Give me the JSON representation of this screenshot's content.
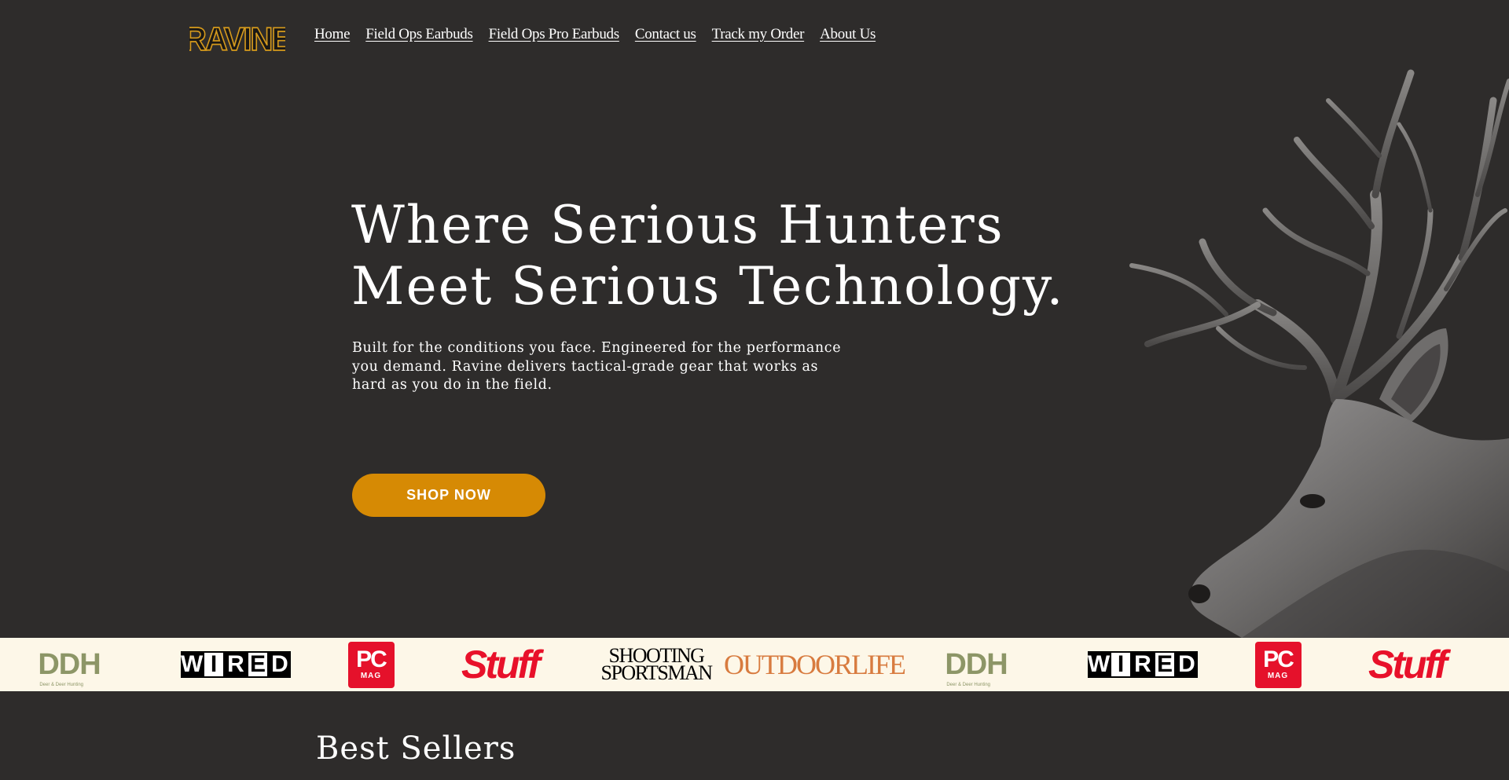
{
  "brand": {
    "logo_text": "RAVINE"
  },
  "nav": {
    "items": [
      {
        "label": "Home"
      },
      {
        "label": "Field Ops Earbuds"
      },
      {
        "label": "Field Ops Pro Earbuds"
      },
      {
        "label": "Contact us"
      },
      {
        "label": "Track my Order"
      },
      {
        "label": "About Us"
      }
    ]
  },
  "hero": {
    "title_line1": "Where Serious Hunters",
    "title_line2": "Meet Serious Technology.",
    "subtitle": "Built for the conditions you face. Engineered for the performance you demand. Ravine delivers tactical-grade gear that works as hard as you do in the field.",
    "cta_label": "SHOP NOW"
  },
  "press": {
    "logos": [
      {
        "name": "ddh",
        "text": "DDH",
        "sub": "Deer & Deer Hunting"
      },
      {
        "name": "wired",
        "text": "WIRED"
      },
      {
        "name": "pcmag",
        "text": "PC",
        "sub": "MAG"
      },
      {
        "name": "stuff",
        "text": "Stuff"
      },
      {
        "name": "shooting-sportsman",
        "line1": "SHOOTING",
        "line2": "SPORTSMAN"
      },
      {
        "name": "outdoor-life",
        "text": "OUTDOORLIFE"
      },
      {
        "name": "ddh-2",
        "text": "DDH",
        "sub": "Deer & Deer Hunting"
      },
      {
        "name": "wired-2",
        "text": "WIRED"
      },
      {
        "name": "pcmag-2",
        "text": "PC",
        "sub": "MAG"
      },
      {
        "name": "stuff-2",
        "text": "Stuff"
      }
    ]
  },
  "sections": {
    "best_sellers_title": "Best Sellers"
  },
  "colors": {
    "background": "#2e2c2b",
    "accent": "#d68a04",
    "press_strip": "#fdf7e8",
    "logo_gold": "#d69a1c"
  }
}
